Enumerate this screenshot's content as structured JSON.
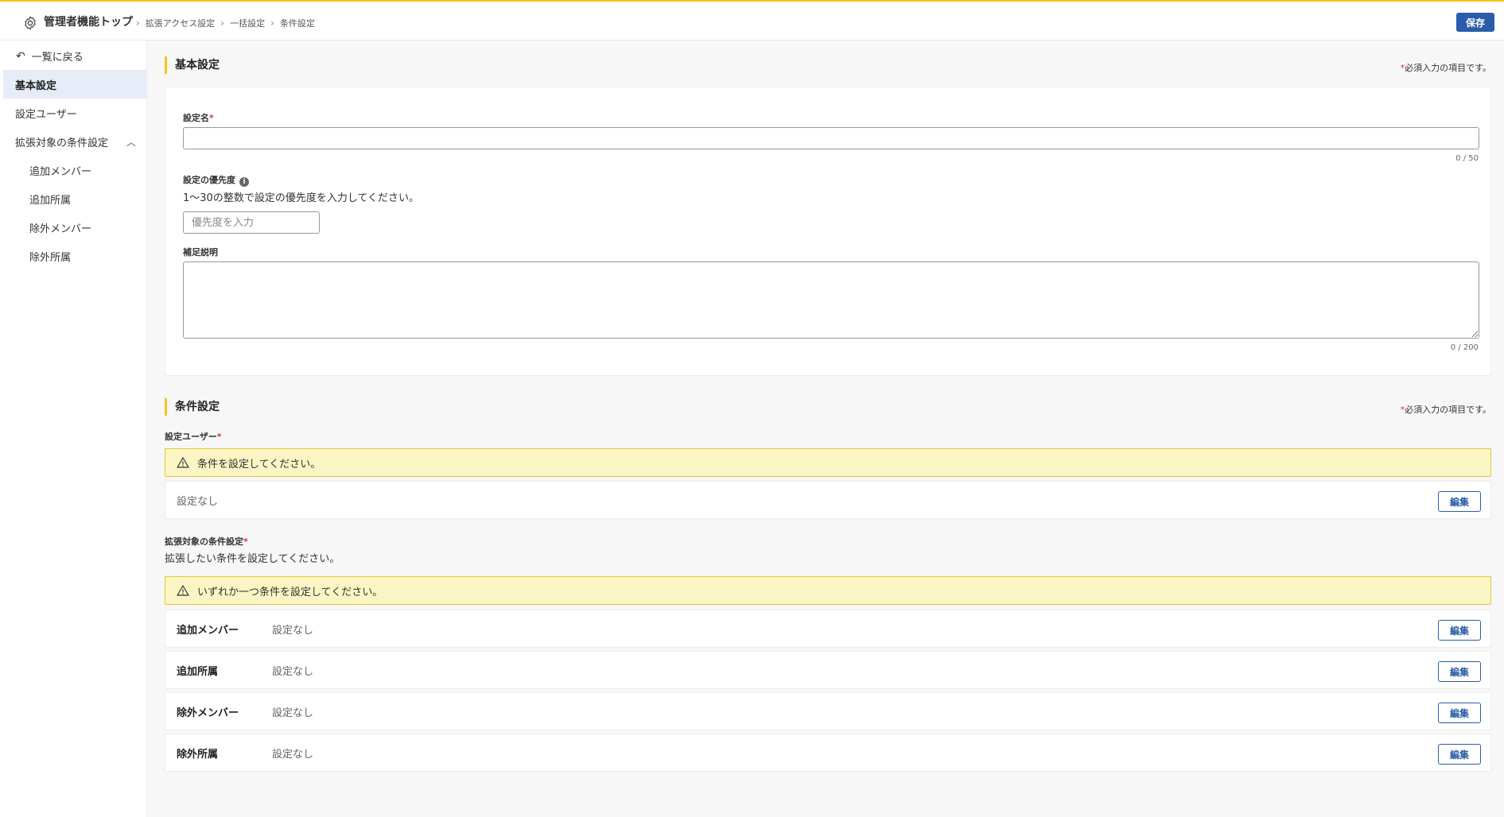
{
  "header": {
    "home": "管理者機能トップ",
    "breadcrumbs": [
      "拡張アクセス設定",
      "一括設定",
      "条件設定"
    ],
    "save_label": "保存",
    "accent_color": "#f5c518",
    "primary_color": "#2a5cab"
  },
  "sidebar": {
    "back_label": "一覧に戻る",
    "items": [
      {
        "label": "基本設定",
        "active": true
      },
      {
        "label": "設定ユーザー",
        "active": false
      },
      {
        "label": "拡張対象の条件設定",
        "active": false,
        "expanded": true
      },
      {
        "label": "追加メンバー",
        "active": false
      },
      {
        "label": "追加所属",
        "active": false
      },
      {
        "label": "除外メンバー",
        "active": false
      },
      {
        "label": "除外所属",
        "active": false
      }
    ]
  },
  "basic": {
    "title": "基本設定",
    "required_note": "必須入力の項目です。",
    "name_label": "設定名",
    "name_value": "",
    "name_counter": "0 / 50",
    "priority_label": "設定の優先度",
    "priority_help": "1〜30の整数で設定の優先度を入力してください。",
    "priority_placeholder": "優先度を入力",
    "note_label": "補足説明",
    "note_value": "",
    "note_counter": "0 / 200"
  },
  "conditions": {
    "title": "条件設定",
    "required_note": "必須入力の項目です。",
    "user_label": "設定ユーザー",
    "user_warning": "条件を設定してください。",
    "user_value": "設定なし",
    "edit_label": "編集",
    "target_label": "拡張対象の条件設定",
    "target_help": "拡張したい条件を設定してください。",
    "target_warning": "いずれか一つ条件を設定してください。",
    "rows": [
      {
        "title": "追加メンバー",
        "value": "設定なし"
      },
      {
        "title": "追加所属",
        "value": "設定なし"
      },
      {
        "title": "除外メンバー",
        "value": "設定なし"
      },
      {
        "title": "除外所属",
        "value": "設定なし"
      }
    ]
  }
}
